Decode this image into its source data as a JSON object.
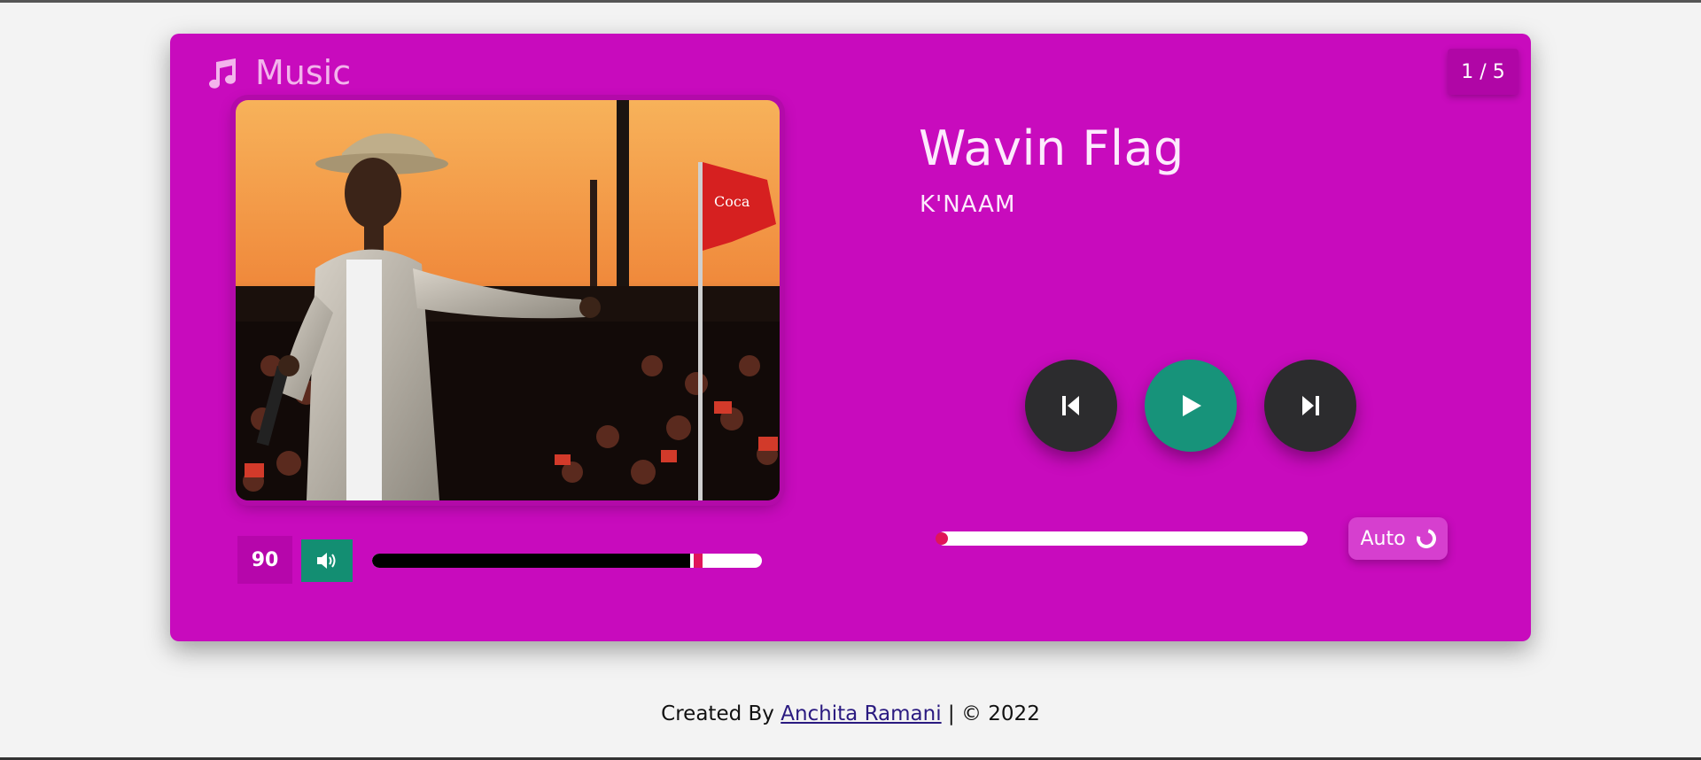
{
  "header": {
    "brand_label": "Music",
    "brand_icon": "music-note-icon",
    "counter": "1 / 5"
  },
  "track": {
    "title": "Wavin Flag",
    "artist": "K'NAAM",
    "cover_icon": "album-cover-photo"
  },
  "volume": {
    "value_label": "90",
    "level": 0.87,
    "icon": "speaker-icon"
  },
  "controls": {
    "prev_icon": "skip-back-icon",
    "play_icon": "play-icon",
    "next_icon": "skip-forward-icon",
    "seek_progress": 0.0
  },
  "auto": {
    "label": "Auto",
    "icon": "loop-icon"
  },
  "footer": {
    "prefix": "Created By",
    "author": "Anchita Ramani",
    "suffix": "| © 2022"
  },
  "colors": {
    "card": "#c80bbd",
    "accent_green": "#17937a",
    "dark_button": "#2c2c2e",
    "thumb": "#e0155a"
  }
}
